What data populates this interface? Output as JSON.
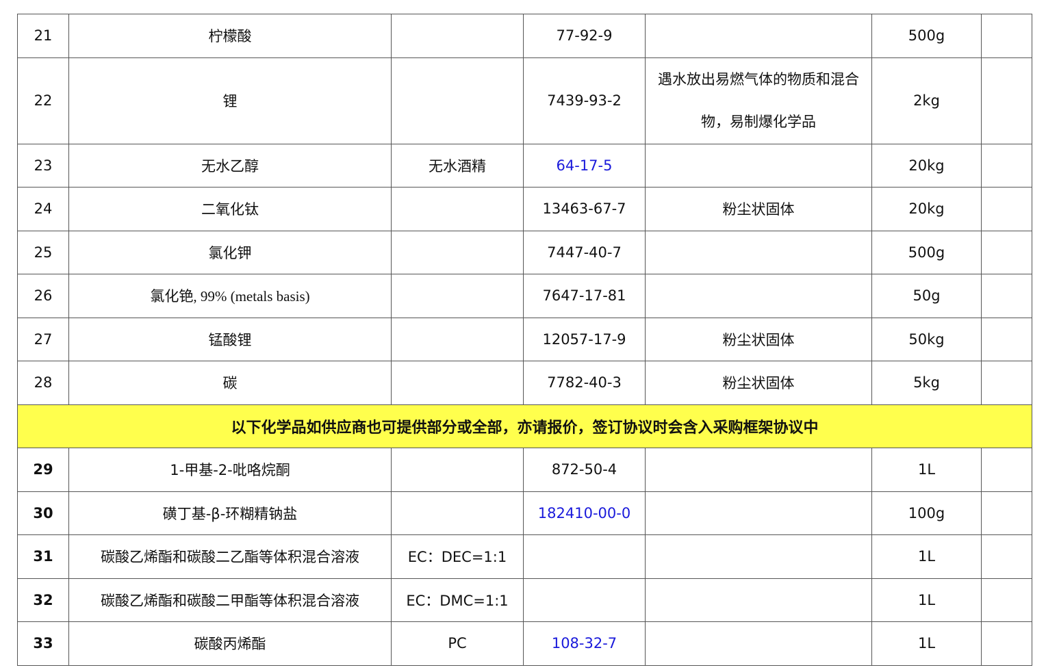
{
  "table": {
    "rows": [
      {
        "no": "21",
        "name": "柠檬酸",
        "alias": "",
        "cas": "77-92-9",
        "hazard": "",
        "qty": "500g",
        "note": ""
      },
      {
        "no": "22",
        "name": "锂",
        "alias": "",
        "cas": "7439-93-2",
        "hazard": "遇水放出易燃气体的物质和混合物，易制爆化学品",
        "qty": "2kg",
        "note": ""
      },
      {
        "no": "23",
        "name": "无水乙醇",
        "alias": "无水酒精",
        "cas": "64-17-5",
        "hazard": "",
        "qty": "20kg",
        "note": ""
      },
      {
        "no": "24",
        "name": "二氧化钛",
        "alias": "",
        "cas": "13463-67-7",
        "hazard": "粉尘状固体",
        "qty": "20kg",
        "note": ""
      },
      {
        "no": "25",
        "name": "氯化钾",
        "alias": "",
        "cas": "7447-40-7",
        "hazard": "",
        "qty": "500g",
        "note": ""
      },
      {
        "no": "26",
        "name": "氯化铯, 99% (metals basis)",
        "alias": "",
        "cas": "7647-17-81",
        "hazard": "",
        "qty": "50g",
        "note": ""
      },
      {
        "no": "27",
        "name": "锰酸锂",
        "alias": "",
        "cas": "12057-17-9",
        "hazard": "粉尘状固体",
        "qty": "50kg",
        "note": ""
      },
      {
        "no": "28",
        "name": "碳",
        "alias": "",
        "cas": "7782-40-3",
        "hazard": "粉尘状固体",
        "qty": "5kg",
        "note": ""
      }
    ],
    "notice": "以下化学品如供应商也可提供部分或全部，亦请报价，签订协议时会含入采购框架协议中",
    "rows2": [
      {
        "no": "29",
        "name": "1-甲基-2-吡咯烷酮",
        "alias": "",
        "cas": "872-50-4",
        "hazard": "",
        "qty": "1L",
        "note": ""
      },
      {
        "no": "30",
        "name": "磺丁基-β-环糊精钠盐",
        "alias": "",
        "cas": "182410-00-0",
        "hazard": "",
        "qty": "100g",
        "note": ""
      },
      {
        "no": "31",
        "name": "碳酸乙烯酯和碳酸二乙酯等体积混合溶液",
        "alias": "EC：DEC=1:1",
        "cas": "",
        "hazard": "",
        "qty": "1L",
        "note": ""
      },
      {
        "no": "32",
        "name": "碳酸乙烯酯和碳酸二甲酯等体积混合溶液",
        "alias": "EC：DMC=1:1",
        "cas": "",
        "hazard": "",
        "qty": "1L",
        "note": ""
      },
      {
        "no": "33",
        "name": "碳酸丙烯酯",
        "alias": "PC",
        "cas": "108-32-7",
        "hazard": "",
        "qty": "1L",
        "note": ""
      }
    ]
  },
  "colors": {
    "notice_background": "#ffff4d",
    "link_text": "#1a1adb",
    "border": "#555555"
  }
}
